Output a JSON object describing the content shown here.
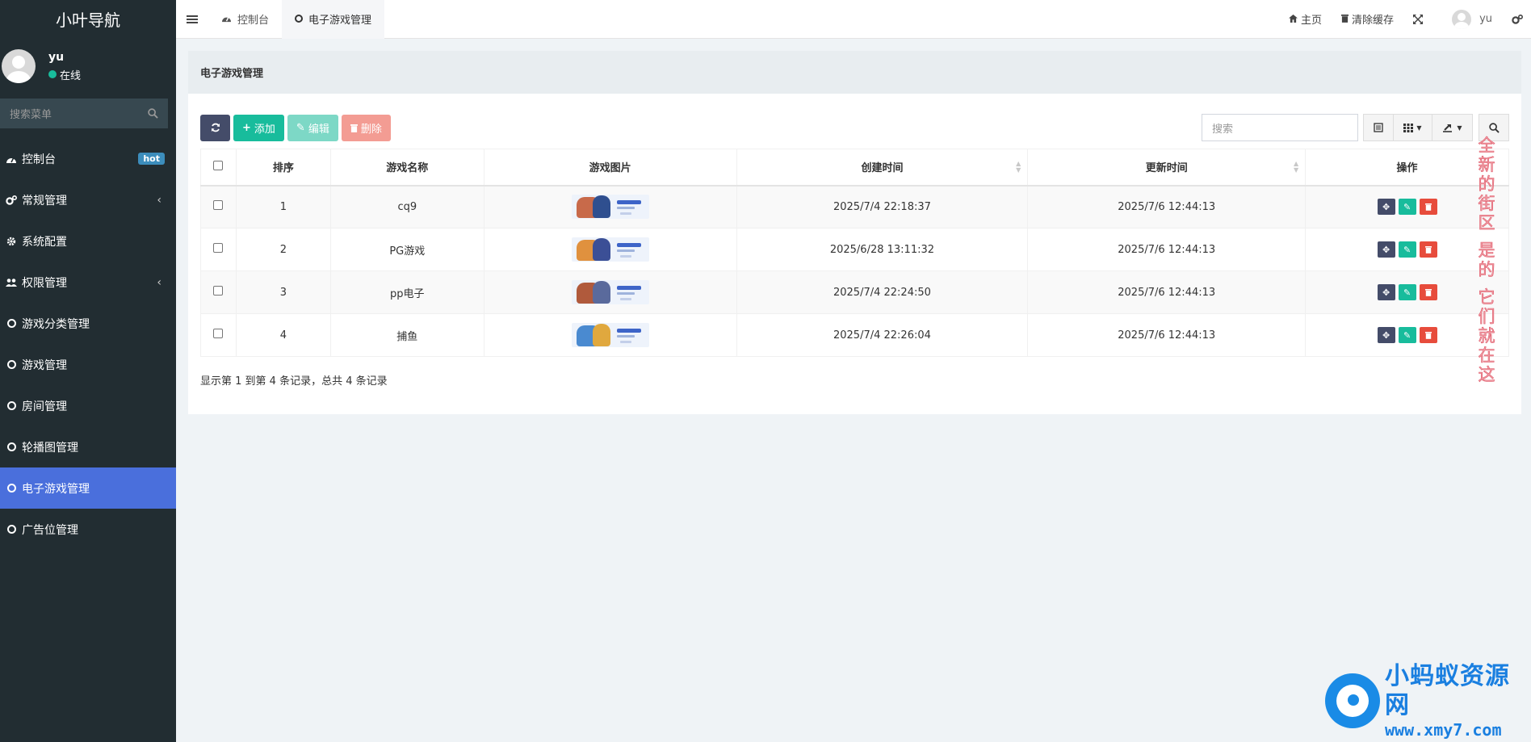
{
  "sidebar": {
    "logo": "小叶导航",
    "user": {
      "name": "yu",
      "status": "在线"
    },
    "search_placeholder": "搜索菜单",
    "items": [
      {
        "label": "控制台",
        "badge": "hot"
      },
      {
        "label": "常规管理"
      },
      {
        "label": "系统配置"
      },
      {
        "label": "权限管理"
      },
      {
        "label": "游戏分类管理"
      },
      {
        "label": "游戏管理"
      },
      {
        "label": "房间管理"
      },
      {
        "label": "轮播图管理"
      },
      {
        "label": "电子游戏管理"
      },
      {
        "label": "广告位管理"
      }
    ]
  },
  "header": {
    "tabs": [
      {
        "label": "控制台"
      },
      {
        "label": "电子游戏管理"
      }
    ],
    "home": "主页",
    "clear_cache": "清除缓存",
    "username": "yu"
  },
  "panel": {
    "title": "电子游戏管理",
    "toolbar": {
      "add": "添加",
      "edit": "编辑",
      "delete": "删除",
      "search_placeholder": "搜索"
    },
    "columns": [
      "排序",
      "游戏名称",
      "游戏图片",
      "创建时间",
      "更新时间",
      "操作"
    ],
    "rows": [
      {
        "order": "1",
        "name": "cq9",
        "created": "2025/7/4 22:18:37",
        "updated": "2025/7/6 12:44:13"
      },
      {
        "order": "2",
        "name": "PG游戏",
        "created": "2025/6/28 13:11:32",
        "updated": "2025/7/6 12:44:13"
      },
      {
        "order": "3",
        "name": "pp电子",
        "created": "2025/7/4 22:24:50",
        "updated": "2025/7/6 12:44:13"
      },
      {
        "order": "4",
        "name": "捕鱼",
        "created": "2025/7/4 22:26:04",
        "updated": "2025/7/6 12:44:13"
      }
    ],
    "pagination_text": "显示第 1 到第 4 条记录，总共 4 条记录"
  },
  "overlay": {
    "vertical_text": "全新的街区 是的 它们就在这",
    "watermark_cn": "小蚂蚁资源网",
    "watermark_url": "www.xmy7.com"
  },
  "colors": {
    "sidebar_bg": "#222d32",
    "active_menu": "#4a6fdc",
    "primary": "#18bc9c",
    "dark_btn": "#444c69",
    "danger": "#e74c3c",
    "watermark_blue": "#1a7fe0"
  }
}
